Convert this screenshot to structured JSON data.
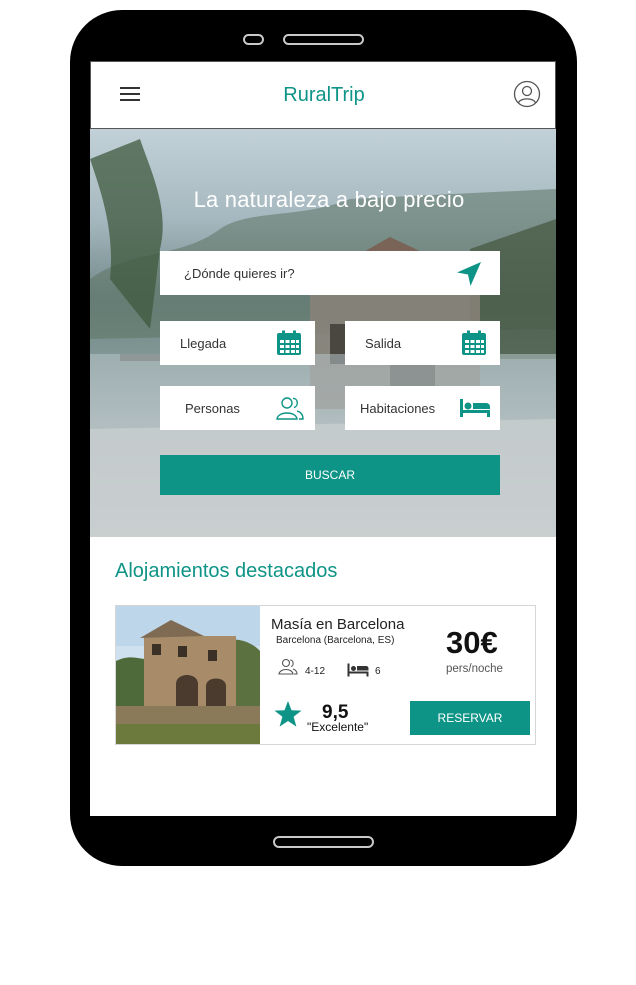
{
  "header": {
    "title": "RuralTrip"
  },
  "hero": {
    "title": "La naturaleza a bajo precio",
    "destination_placeholder": "¿Dónde quieres ir?",
    "checkin_label": "Llegada",
    "checkout_label": "Salida",
    "guests_label": "Personas",
    "rooms_label": "Habitaciones",
    "search_label": "BUSCAR"
  },
  "featured": {
    "title": "Alojamientos destacados",
    "items": [
      {
        "name": "Masía en Barcelona",
        "location": "Barcelona (Barcelona, ES)",
        "guests": "4-12",
        "beds": "6",
        "price": "30€",
        "price_unit": "pers/noche",
        "score": "9,5",
        "score_label": "\"Excelente\"",
        "reserve_label": "RESERVAR"
      }
    ]
  },
  "colors": {
    "accent": "#0e9486",
    "device": "#000000"
  },
  "icons": [
    "menu-icon",
    "user-icon",
    "location-arrow-icon",
    "calendar-icon",
    "users-icon",
    "bed-icon",
    "star-icon"
  ]
}
